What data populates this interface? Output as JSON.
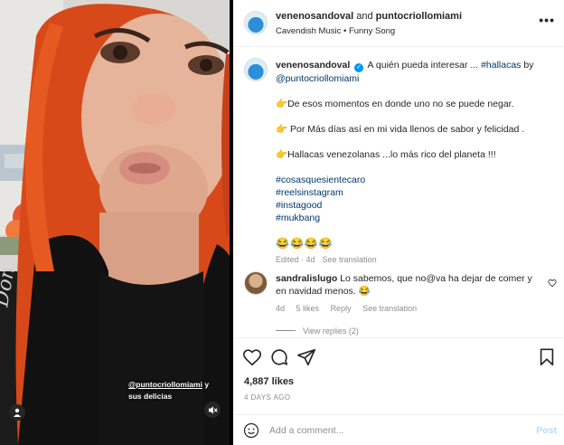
{
  "media": {
    "overlay_handle": "@puntocriollomiami",
    "overlay_suffix": " y",
    "overlay_line2": "sus delicias",
    "tag_icon": "person-icon",
    "mute_icon": "speaker-muted-icon"
  },
  "header": {
    "user1": "venenosandoval",
    "and": " and ",
    "user2": "puntocriollomiami",
    "audio": "Cavendish Music • Funny Song",
    "more_label": "•••"
  },
  "caption": {
    "username": "venenosandoval",
    "intro": "A quién pueda interesar ... ",
    "hashtag_intro": "#hallacas",
    "by": " by",
    "mention": "@puntocriollomiami",
    "line1": "👉De esos momentos en donde uno no se puede negar.",
    "line2": "👉 Por Más días así en mi vida llenos de sabor y felicidad .",
    "line3": "👉Hallacas venezolanas ...lo más rico del planeta !!!",
    "tags": [
      "#cosasquesientecaro",
      "#reelsinstagram",
      "#instagood",
      "#mukbang"
    ],
    "emojis": "😂😂😂😂",
    "edited": "Edited · 4d",
    "see_translation": "See translation"
  },
  "comment": {
    "username": "sandralislugo",
    "text": " Lo sabemos, que no@va ha dejar de comer y en navidad menos. 😂",
    "age": "4d",
    "likes": "5 likes",
    "reply": "Reply",
    "see_translation": "See translation",
    "view_replies": "View replies (2)"
  },
  "actions": {
    "likes": "4,887 likes",
    "date": "4 DAYS AGO"
  },
  "composer": {
    "placeholder": "Add a comment...",
    "post": "Post"
  },
  "colors": {
    "link": "#00376b",
    "verified": "#0095f6",
    "post_disabled": "#b3dbff",
    "hair": "#e2501c"
  }
}
